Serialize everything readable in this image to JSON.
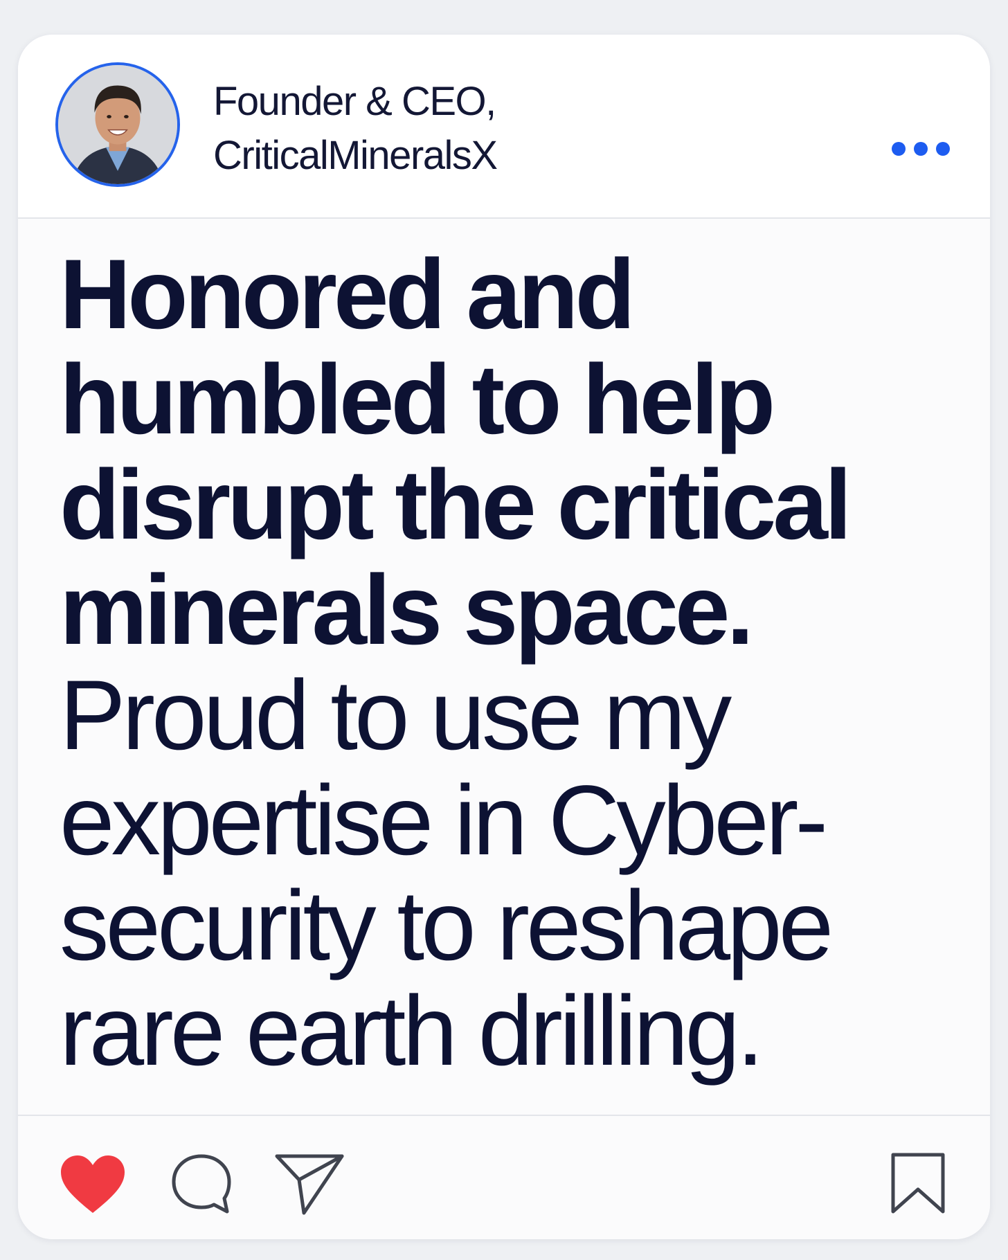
{
  "post": {
    "author_title_line1": "Founder & CEO,",
    "author_title_line2": "CriticalMineralsX",
    "text_lines_bold": [
      "Honored and",
      "humbled to help",
      "disrupt the critical",
      "minerals space."
    ],
    "text_lines_regular": [
      "Proud to use my",
      "expertise in Cyber-",
      "security to reshape",
      "rare earth drilling."
    ]
  },
  "actions": {
    "like_icon": "heart-icon",
    "comment_icon": "comment-icon",
    "share_icon": "send-icon",
    "save_icon": "bookmark-icon",
    "more_icon": "more-dots-icon"
  },
  "colors": {
    "accent": "#1d5cf0",
    "like": "#f03a42",
    "text": "#0d1233",
    "icon_outline": "#40444f"
  }
}
